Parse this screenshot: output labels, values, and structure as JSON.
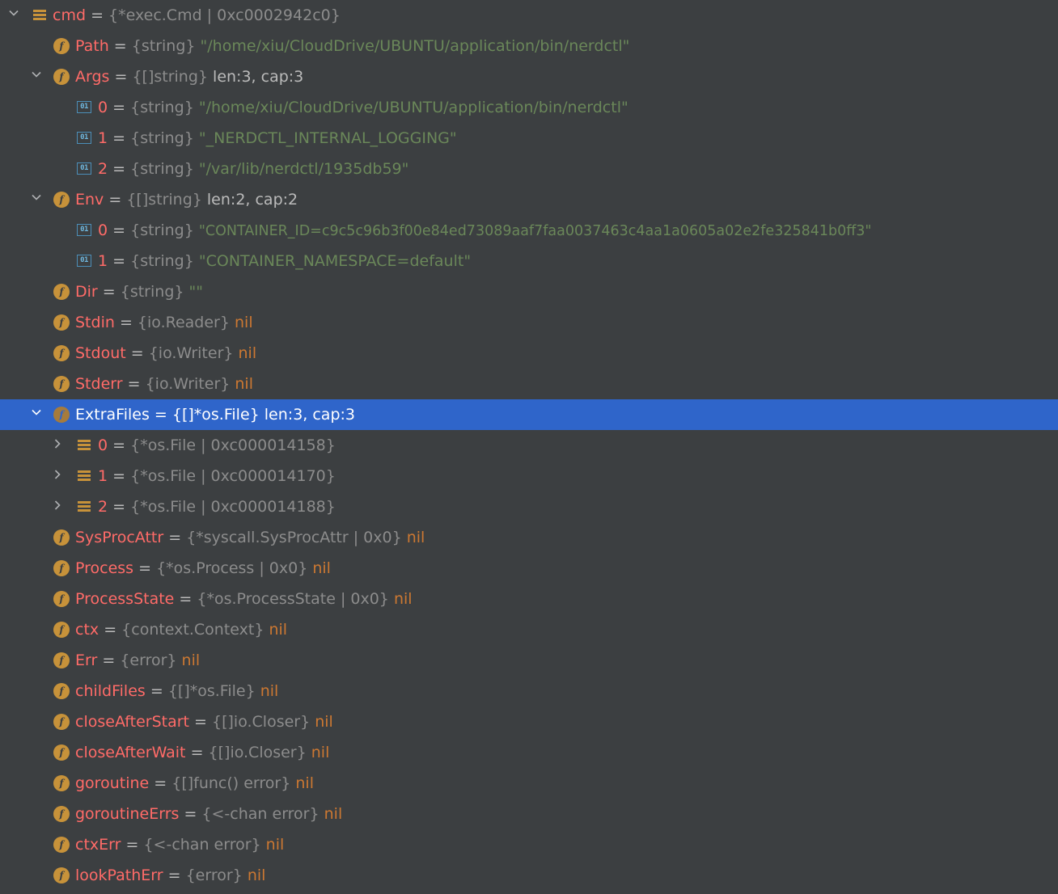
{
  "rows": [
    {
      "name": "cmd",
      "type": "{*exec.Cmd | 0xc0002942c0}",
      "value": ""
    },
    {
      "name": "Path",
      "type": "{string}",
      "value": "\"/home/xiu/CloudDrive/UBUNTU/application/bin/nerdctl\""
    },
    {
      "name": "Args",
      "type": "{[]string}",
      "value": "len:3, cap:3"
    },
    {
      "name": "0",
      "type": "{string}",
      "value": "\"/home/xiu/CloudDrive/UBUNTU/application/bin/nerdctl\""
    },
    {
      "name": "1",
      "type": "{string}",
      "value": "\"_NERDCTL_INTERNAL_LOGGING\""
    },
    {
      "name": "2",
      "type": "{string}",
      "value": "\"/var/lib/nerdctl/1935db59\""
    },
    {
      "name": "Env",
      "type": "{[]string}",
      "value": "len:2, cap:2"
    },
    {
      "name": "0",
      "type": "{string}",
      "value": "\"CONTAINER_ID=c9c5c96b3f00e84ed73089aaf7faa0037463c4aa1a0605a02e2fe325841b0ff3\""
    },
    {
      "name": "1",
      "type": "{string}",
      "value": "\"CONTAINER_NAMESPACE=default\""
    },
    {
      "name": "Dir",
      "type": "{string}",
      "value": "\"\""
    },
    {
      "name": "Stdin",
      "type": "{io.Reader}",
      "value": "nil"
    },
    {
      "name": "Stdout",
      "type": "{io.Writer}",
      "value": "nil"
    },
    {
      "name": "Stderr",
      "type": "{io.Writer}",
      "value": "nil"
    },
    {
      "name": "ExtraFiles",
      "type": "{[]*os.File}",
      "value": "len:3, cap:3"
    },
    {
      "name": "0",
      "type": "{*os.File | 0xc000014158}",
      "value": ""
    },
    {
      "name": "1",
      "type": "{*os.File | 0xc000014170}",
      "value": ""
    },
    {
      "name": "2",
      "type": "{*os.File | 0xc000014188}",
      "value": ""
    },
    {
      "name": "SysProcAttr",
      "type": "{*syscall.SysProcAttr | 0x0}",
      "value": "nil"
    },
    {
      "name": "Process",
      "type": "{*os.Process | 0x0}",
      "value": "nil"
    },
    {
      "name": "ProcessState",
      "type": "{*os.ProcessState | 0x0}",
      "value": "nil"
    },
    {
      "name": "ctx",
      "type": "{context.Context}",
      "value": "nil"
    },
    {
      "name": "Err",
      "type": "{error}",
      "value": "nil"
    },
    {
      "name": "childFiles",
      "type": "{[]*os.File}",
      "value": "nil"
    },
    {
      "name": "closeAfterStart",
      "type": "{[]io.Closer}",
      "value": "nil"
    },
    {
      "name": "closeAfterWait",
      "type": "{[]io.Closer}",
      "value": "nil"
    },
    {
      "name": "goroutine",
      "type": "{[]func() error}",
      "value": "nil"
    },
    {
      "name": "goroutineErrs",
      "type": "{<-chan error}",
      "value": "nil"
    },
    {
      "name": "ctxErr",
      "type": "{<-chan error}",
      "value": "nil"
    },
    {
      "name": "lookPathErr",
      "type": "{error}",
      "value": "nil"
    }
  ],
  "equals": "=",
  "icon_names": {
    "field": "field-icon",
    "array_element": "array-element-icon",
    "struct": "struct-icon",
    "expanded": "chevron-down-icon",
    "collapsed": "chevron-right-icon"
  },
  "colors": {
    "background": "#3c3f41",
    "selection": "#2f65ca",
    "field_name": "#ff6b68",
    "string_value": "#6a8759",
    "nil_value": "#cc7832",
    "type_text": "#8c8c8c",
    "field_icon": "#c7923a"
  },
  "selected_row": "ExtraFiles"
}
